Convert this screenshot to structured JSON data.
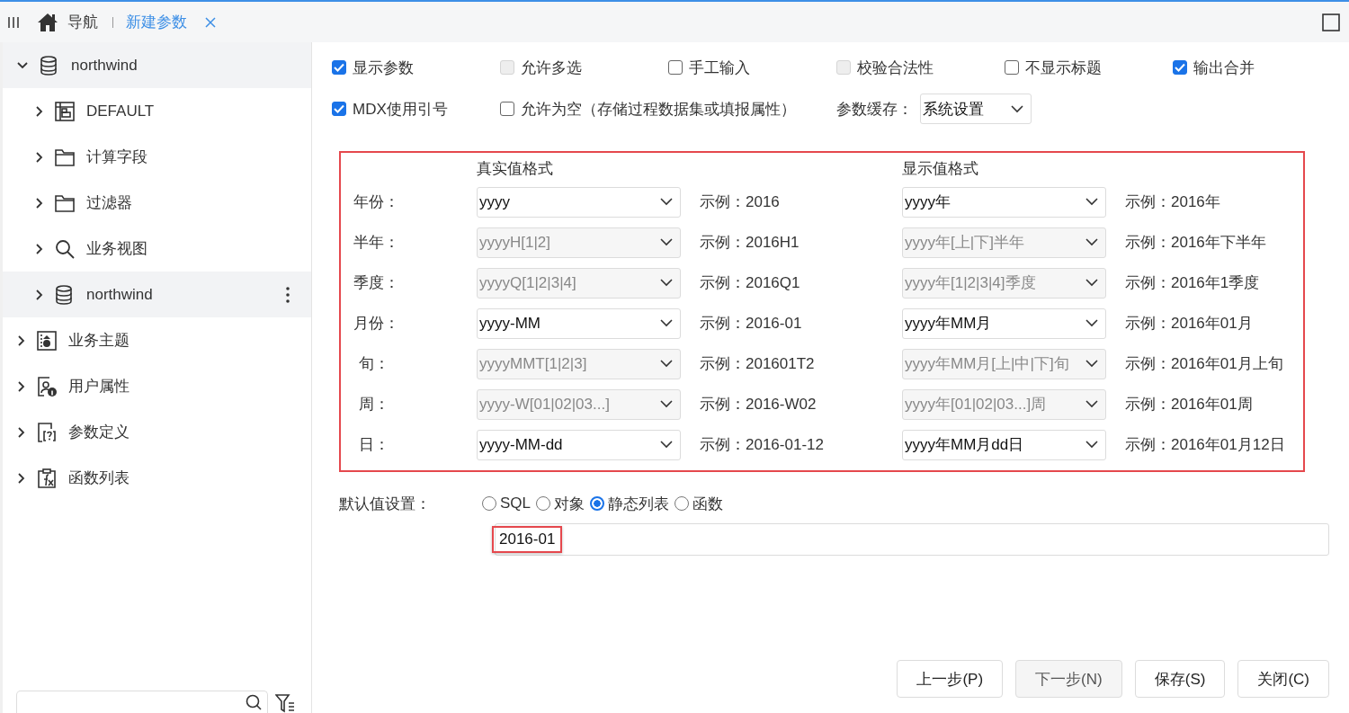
{
  "topbar": {
    "nav_label": "导航",
    "tab": {
      "label": "新建参数",
      "selected": true
    }
  },
  "tree": [
    {
      "label": "northwind",
      "kind": "database",
      "expanded": true,
      "highlighted": true,
      "children": [
        {
          "label": "DEFAULT",
          "kind": "table",
          "expanded": false,
          "highlighted": false
        },
        {
          "label": "计算字段",
          "kind": "folder",
          "expanded": false,
          "highlighted": false
        },
        {
          "label": "过滤器",
          "kind": "folder",
          "expanded": false,
          "highlighted": false
        },
        {
          "label": "业务视图",
          "kind": "search",
          "expanded": false,
          "highlighted": false
        },
        {
          "label": "northwind",
          "kind": "database",
          "expanded": false,
          "highlighted": true,
          "menu": true
        }
      ]
    },
    {
      "label": "业务主题",
      "kind": "subject",
      "expanded": false,
      "highlighted": false
    },
    {
      "label": "用户属性",
      "kind": "user",
      "expanded": false,
      "highlighted": false
    },
    {
      "label": "参数定义",
      "kind": "param",
      "expanded": false,
      "highlighted": false
    },
    {
      "label": "函数列表",
      "kind": "function",
      "expanded": false,
      "highlighted": false
    }
  ],
  "options": [
    [
      {
        "kind": "checkbox",
        "label": "显示参数",
        "checked": true,
        "disabled": false
      },
      {
        "kind": "checkbox",
        "label": "允许多选",
        "checked": false,
        "disabled": true
      },
      {
        "kind": "checkbox",
        "label": "手工输入",
        "checked": false,
        "disabled": false
      },
      {
        "kind": "checkbox",
        "label": "校验合法性",
        "checked": false,
        "disabled": true
      },
      {
        "kind": "checkbox",
        "label": "不显示标题",
        "checked": false,
        "disabled": false
      },
      {
        "kind": "checkbox",
        "label": "输出合并",
        "checked": true,
        "disabled": false
      }
    ],
    [
      {
        "kind": "checkbox",
        "label": "MDX使用引号",
        "checked": true,
        "disabled": false
      },
      {
        "kind": "checkbox",
        "label": "允许为空（存储过程数据集或填报属性）",
        "checked": false,
        "disabled": false
      },
      {
        "kind": "select",
        "label": "参数缓存：",
        "value": "系统设置"
      }
    ]
  ],
  "format": {
    "headers": [
      "真实值格式",
      "显示值格式"
    ],
    "rows": [
      {
        "label": "年份：",
        "real": {
          "value": "yyyy",
          "disabled": false
        },
        "real_example": "示例：2016",
        "display": {
          "value": "yyyy年",
          "disabled": false
        },
        "display_example": "示例：2016年"
      },
      {
        "label": "半年：",
        "real": {
          "value": "yyyyH[1|2]",
          "disabled": true
        },
        "real_example": "示例：2016H1",
        "display": {
          "value": "yyyy年[上|下]半年",
          "disabled": true
        },
        "display_example": "示例：2016年下半年"
      },
      {
        "label": "季度：",
        "real": {
          "value": "yyyyQ[1|2|3|4]",
          "disabled": true
        },
        "real_example": "示例：2016Q1",
        "display": {
          "value": "yyyy年[1|2|3|4]季度",
          "disabled": true
        },
        "display_example": "示例：2016年1季度"
      },
      {
        "label": "月份：",
        "real": {
          "value": "yyyy-MM",
          "disabled": false
        },
        "real_example": "示例：2016-01",
        "display": {
          "value": "yyyy年MM月",
          "disabled": false
        },
        "display_example": "示例：2016年01月"
      },
      {
        "label": "旬：",
        "real": {
          "value": "yyyyMMT[1|2|3]",
          "disabled": true
        },
        "real_example": "示例：201601T2",
        "display": {
          "value": "yyyy年MM月[上|中|下]旬",
          "disabled": true
        },
        "display_example": "示例：2016年01月上旬"
      },
      {
        "label": "周：",
        "real": {
          "value": "yyyy-W[01|02|03...]",
          "disabled": true
        },
        "real_example": "示例：2016-W02",
        "display": {
          "value": "yyyy年[01|02|03...]周",
          "disabled": true
        },
        "display_example": "示例：2016年01周"
      },
      {
        "label": "日：",
        "real": {
          "value": "yyyy-MM-dd",
          "disabled": false
        },
        "real_example": "示例：2016-01-12",
        "display": {
          "value": "yyyy年MM月dd日",
          "disabled": false
        },
        "display_example": "示例：2016年01月12日"
      }
    ]
  },
  "default_value": {
    "label": "默认值设置：",
    "modes": [
      {
        "label": "SQL",
        "selected": false
      },
      {
        "label": "对象",
        "selected": false
      },
      {
        "label": "静态列表",
        "selected": true
      },
      {
        "label": "函数",
        "selected": false
      }
    ],
    "value": "2016-01"
  },
  "buttons": [
    {
      "label": "上一步(P)",
      "disabled": false
    },
    {
      "label": "下一步(N)",
      "disabled": true
    },
    {
      "label": "保存(S)",
      "disabled": false
    },
    {
      "label": "关闭(C)",
      "disabled": false
    }
  ]
}
